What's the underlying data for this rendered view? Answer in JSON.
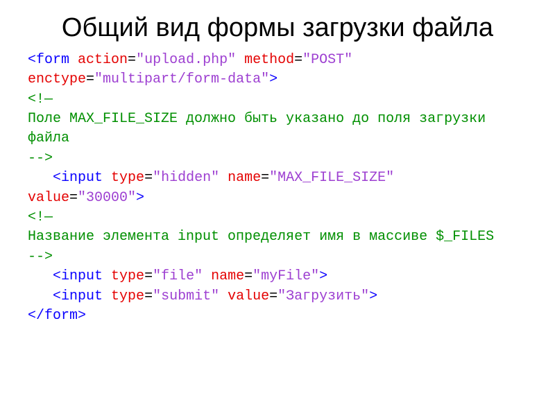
{
  "title": "Общий вид формы загрузки файла",
  "code": {
    "l1": {
      "t_open": "<form",
      "a_action": "action",
      "v_action": "\"upload.php\"",
      "a_method": "method",
      "v_method": "\"POST\""
    },
    "l2": {
      "a_enctype": "enctype",
      "v_enctype": "\"multipart/form-data\"",
      "close_gt": ">"
    },
    "c1_open": "<!—",
    "c1_text": "Поле MAX_FILE_SIZE должно быть указано до поля загрузки файла",
    "c1_close": "-->",
    "l3": {
      "indent": "   ",
      "t_open": "<input",
      "a_type": "type",
      "v_type": "\"hidden\"",
      "a_name": "name",
      "v_name": "\"MAX_FILE_SIZE\""
    },
    "l4": {
      "a_value": "value",
      "v_value": "\"30000\"",
      "close_gt": ">"
    },
    "c2_open": "<!—",
    "c2_text": "Название элемента input определяет имя в массиве $_FILES",
    "c2_close": "-->",
    "l5": {
      "indent": "   ",
      "t_open": "<input",
      "a_type": "type",
      "v_type": "\"file\"",
      "a_name": "name",
      "v_name": "\"myFile\"",
      "close_gt": ">"
    },
    "l6": {
      "indent": "   ",
      "t_open": "<input",
      "a_type": "type",
      "v_type": "\"submit\"",
      "a_value": "value",
      "v_value": "\"Загрузить\"",
      "close_gt": ">"
    },
    "l7": {
      "t_close": "</form>"
    },
    "eq": "=",
    "sp": " "
  }
}
